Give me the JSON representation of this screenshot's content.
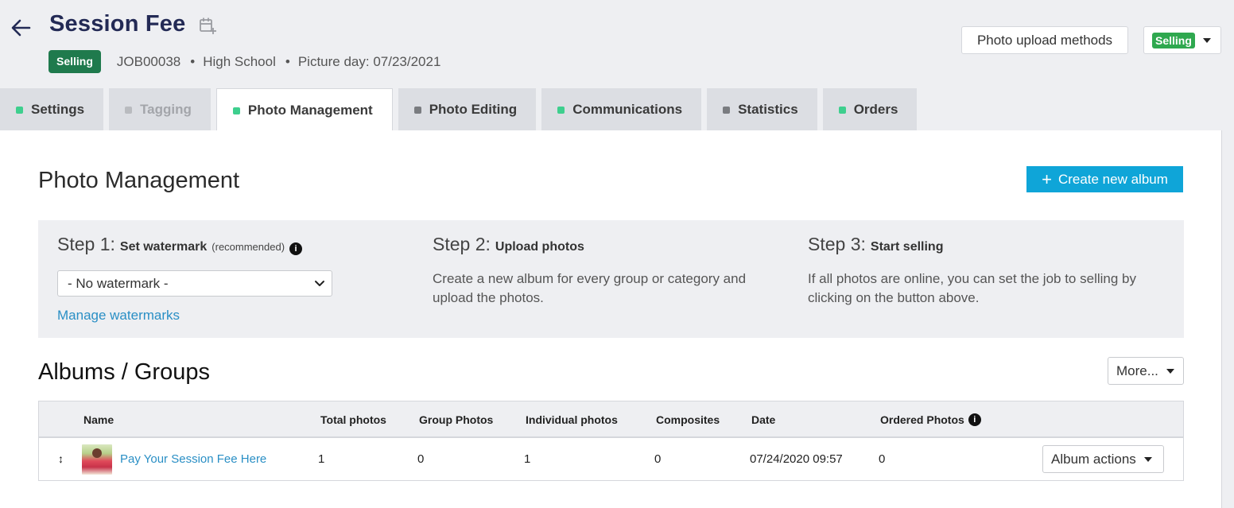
{
  "header": {
    "title": "Session Fee",
    "status_badge": "Selling",
    "job_id": "JOB00038",
    "school": "High School",
    "picture_day": "Picture day: 07/23/2021",
    "upload_methods_label": "Photo upload methods",
    "status_dropdown_label": "Selling",
    "separator": "•"
  },
  "tabs": [
    {
      "label": "Settings",
      "dot_color": "#3ecf8e",
      "state": "normal"
    },
    {
      "label": "Tagging",
      "dot_color": "#b9bbbf",
      "state": "disabled"
    },
    {
      "label": "Photo Management",
      "dot_color": "#3ecf8e",
      "state": "active"
    },
    {
      "label": "Photo Editing",
      "dot_color": "#7a7c80",
      "state": "normal"
    },
    {
      "label": "Communications",
      "dot_color": "#3ecf8e",
      "state": "normal"
    },
    {
      "label": "Statistics",
      "dot_color": "#7a7c80",
      "state": "normal"
    },
    {
      "label": "Orders",
      "dot_color": "#3ecf8e",
      "state": "normal"
    }
  ],
  "main": {
    "title": "Photo Management",
    "create_album_label": "Create new album",
    "steps": [
      {
        "prefix": "Step 1:",
        "title": "Set watermark",
        "note": "(recommended)",
        "description": ""
      },
      {
        "prefix": "Step 2:",
        "title": "Upload photos",
        "note": "",
        "description": "Create a new album for every group or category and upload the photos."
      },
      {
        "prefix": "Step 3:",
        "title": "Start selling",
        "note": "",
        "description": "If all photos are online, you can set the job to selling by clicking on the button above."
      }
    ],
    "watermark_select_value": "- No watermark -",
    "manage_watermarks_label": "Manage watermarks",
    "albums_title": "Albums / Groups",
    "more_label": "More..."
  },
  "table": {
    "columns": [
      "Name",
      "Total photos",
      "Group Photos",
      "Individual photos",
      "Composites",
      "Date",
      "Ordered Photos"
    ],
    "rows": [
      {
        "name": "Pay Your Session Fee Here",
        "total_photos": "1",
        "group_photos": "0",
        "individual_photos": "1",
        "composites": "0",
        "date": "07/24/2020 09:57",
        "ordered_photos": "0",
        "actions_label": "Album actions"
      }
    ]
  },
  "colors": {
    "accent": "#0fa5d8",
    "link": "#2a8fc5",
    "selling_badge": "#1f7a4d",
    "selling_pill": "#2fa84f",
    "title": "#232a55"
  }
}
